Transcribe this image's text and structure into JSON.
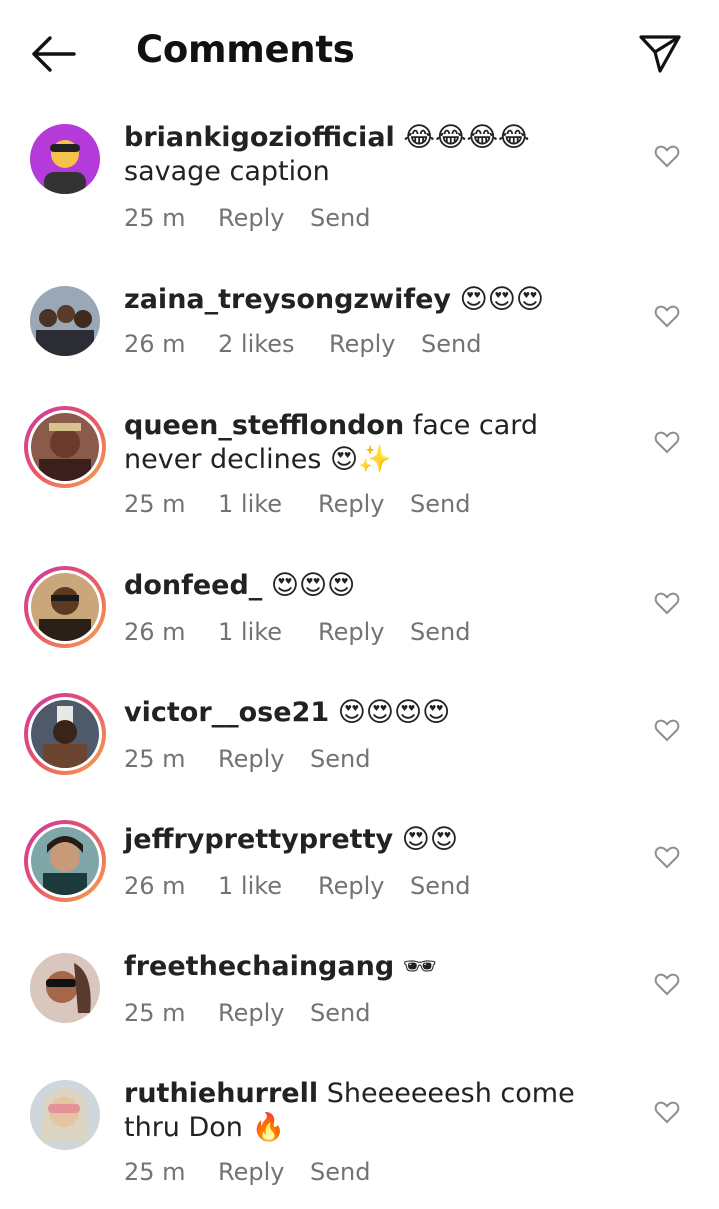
{
  "header": {
    "title": "Comments",
    "back_icon": "arrow-left-icon",
    "share_icon": "paper-plane-icon"
  },
  "comments": [
    {
      "username": "briankigoziofficial",
      "text": "😂😂😂😂 savage caption",
      "time": "25 m",
      "likes": "",
      "reply": "Reply",
      "send": "Send"
    },
    {
      "username": "zaina_treysongzwifey",
      "text": "😍😍😍",
      "time": "26 m",
      "likes": "2 likes",
      "reply": "Reply",
      "send": "Send"
    },
    {
      "username": "queen_stefflondon",
      "text": "face card never declines 😍✨",
      "time": "25 m",
      "likes": "1 like",
      "reply": "Reply",
      "send": "Send"
    },
    {
      "username": "donfeed_",
      "text": "😍😍😍",
      "time": "26 m",
      "likes": "1 like",
      "reply": "Reply",
      "send": "Send"
    },
    {
      "username": "victor__ose21",
      "text": "😍😍😍😍",
      "time": "25 m",
      "likes": "",
      "reply": "Reply",
      "send": "Send"
    },
    {
      "username": "jeffryprettypretty",
      "text": "😍😍",
      "time": "26 m",
      "likes": "1 like",
      "reply": "Reply",
      "send": "Send"
    },
    {
      "username": "freethechaingang",
      "text": "🕶",
      "time": "25 m",
      "likes": "",
      "reply": "Reply",
      "send": "Send"
    },
    {
      "username": "ruthiehurrell",
      "text": "Sheeeeeesh come thru Don 🔥",
      "time": "25 m",
      "likes": "",
      "reply": "Reply",
      "send": "Send"
    }
  ]
}
